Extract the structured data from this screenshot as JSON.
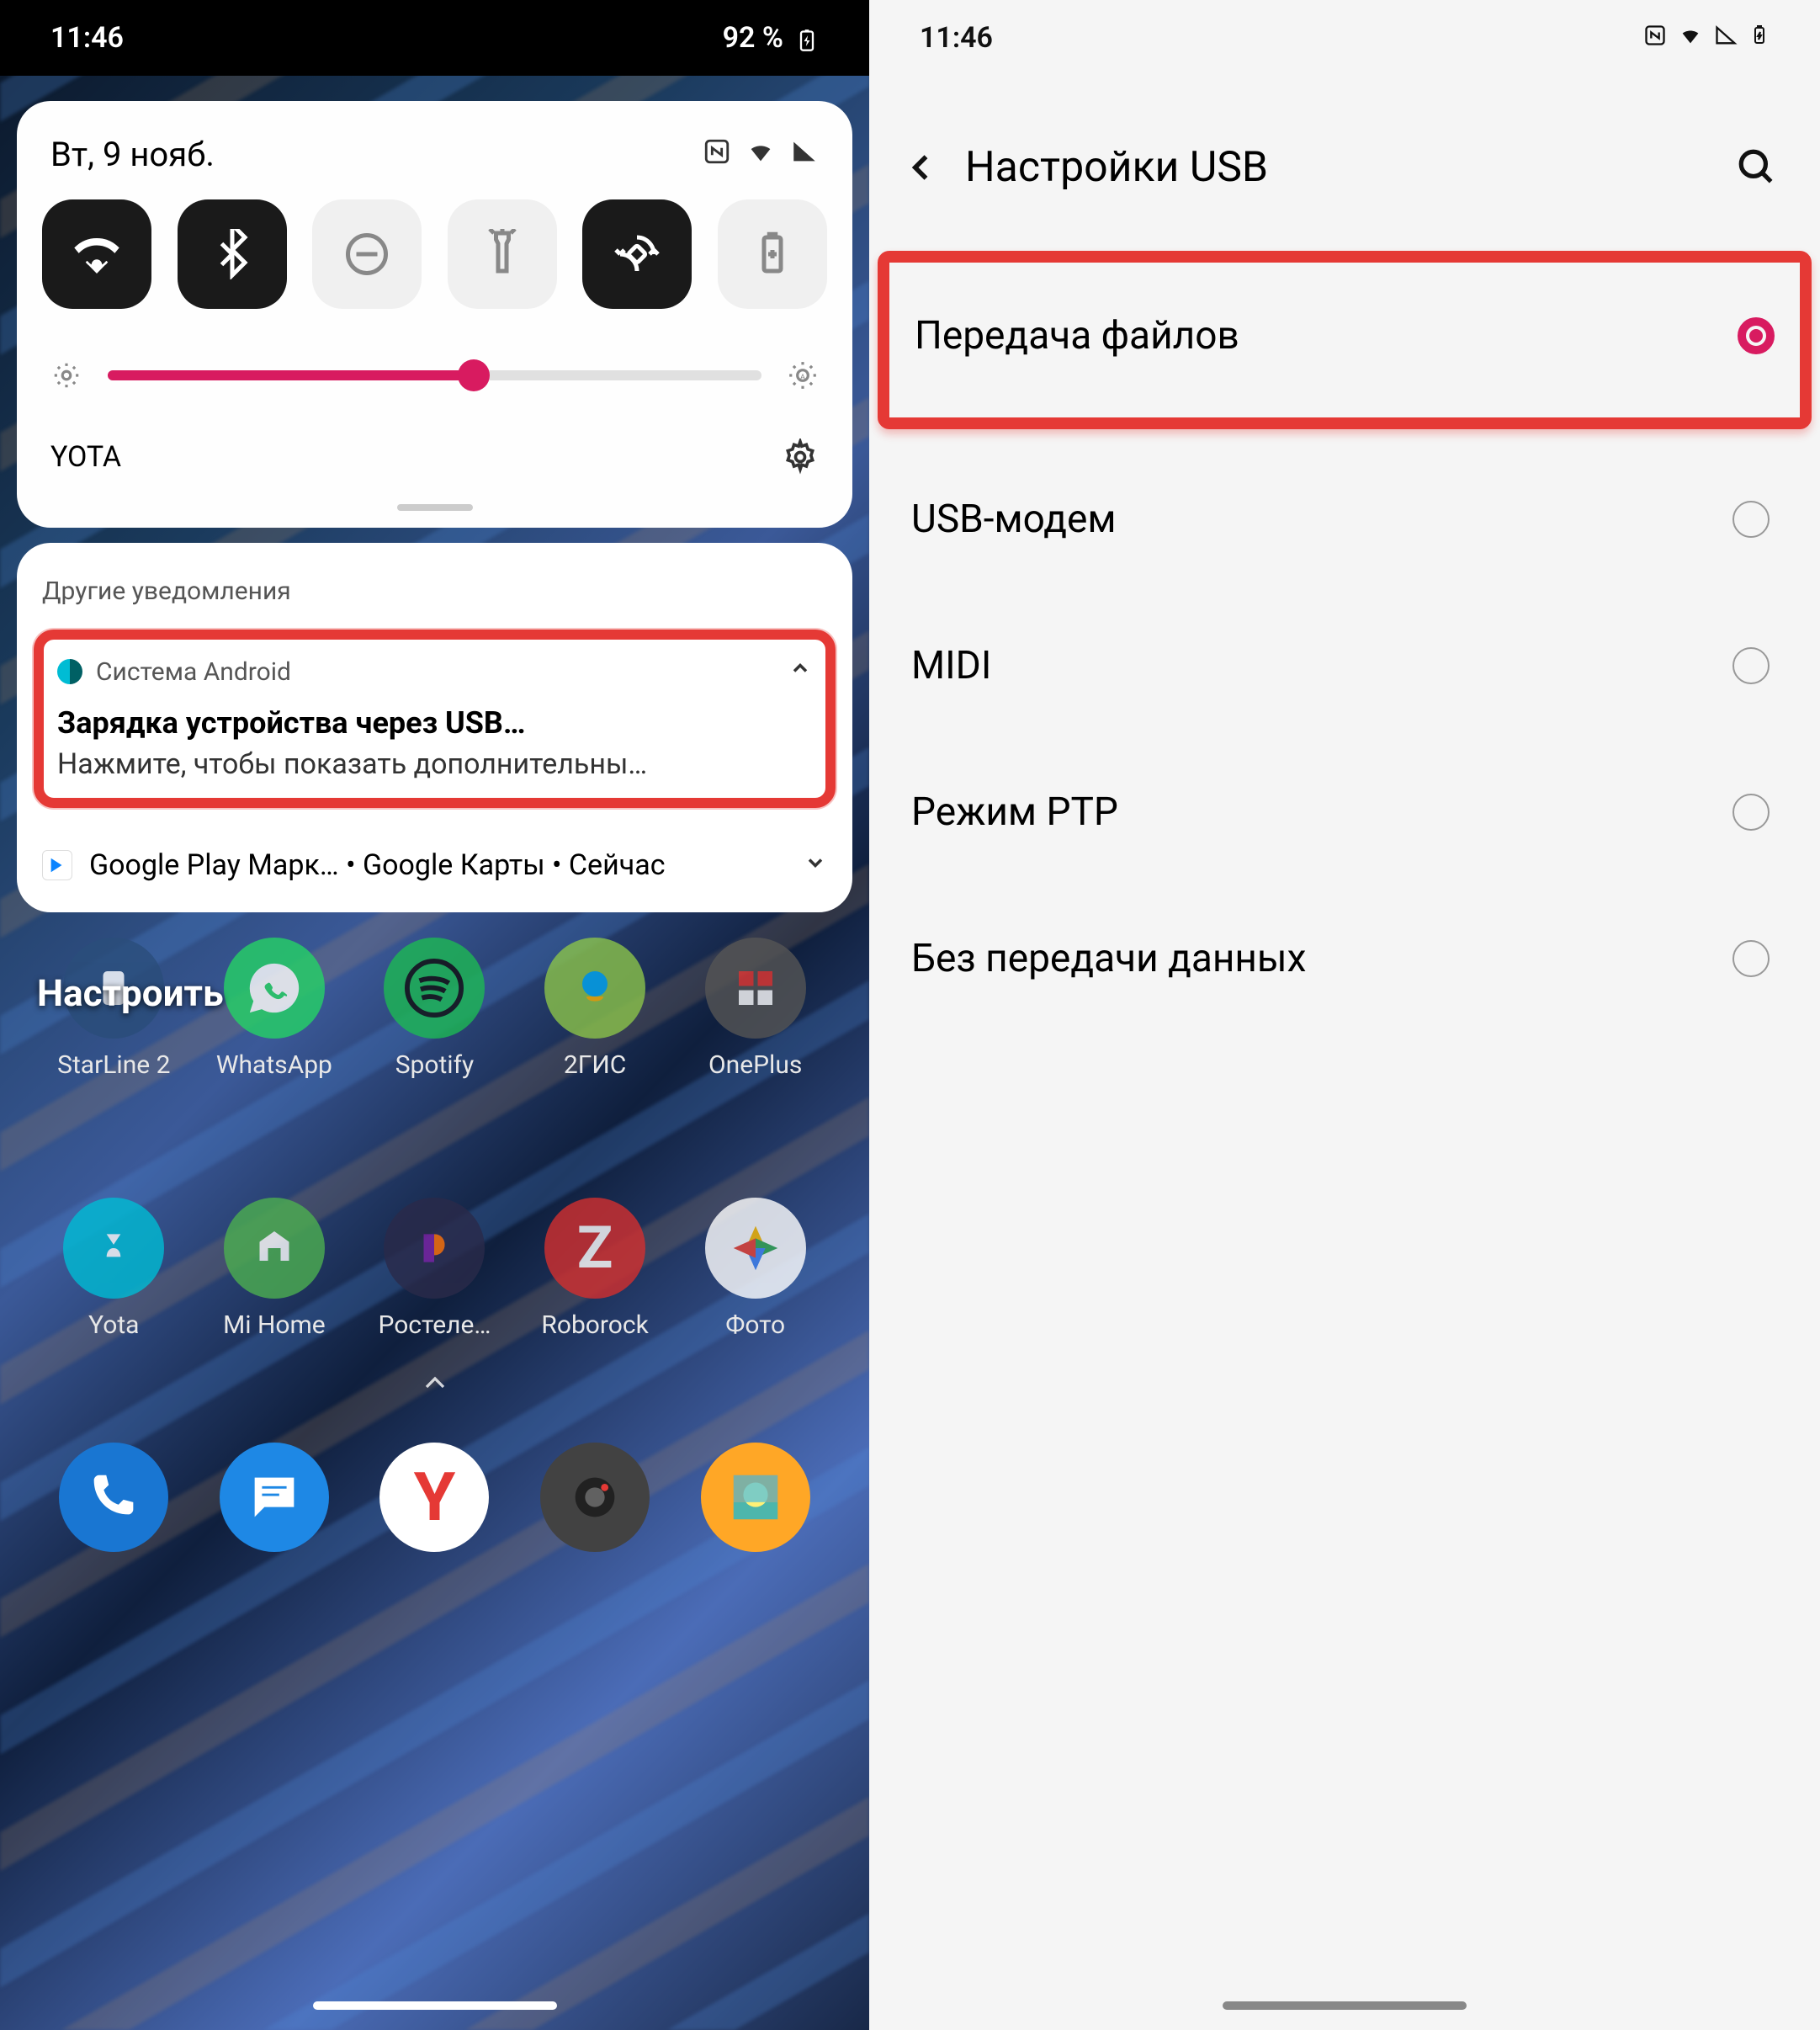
{
  "left": {
    "status": {
      "time": "11:46",
      "battery_pct": "92 %"
    },
    "qs": {
      "date": "Вт, 9 нояб.",
      "carrier": "YOTA"
    },
    "notifs": {
      "header": "Другие уведомления",
      "n1": {
        "app": "Система Android",
        "title": "Зарядка устройства через USB…",
        "body": "Нажмите, чтобы показать дополнительны…"
      },
      "n2": "Google Play Марк… • Google Карты • Сейчас"
    },
    "home": {
      "customize": "Настроить",
      "row1": {
        "a": "StarLine 2",
        "b": "WhatsApp",
        "c": "Spotify",
        "d": "2ГИС",
        "e": "OnePlus"
      },
      "row2": {
        "a": "Yota",
        "b": "Mi Home",
        "c": "Ростеле…",
        "d": "Roborock",
        "e": "Фото"
      }
    }
  },
  "right": {
    "status": {
      "time": "11:46"
    },
    "title": "Настройки USB",
    "opts": {
      "file_transfer": "Передача файлов",
      "usb_tether": "USB-модем",
      "midi": "MIDI",
      "ptp": "Режим PTP",
      "no_data": "Без передачи данных"
    }
  }
}
